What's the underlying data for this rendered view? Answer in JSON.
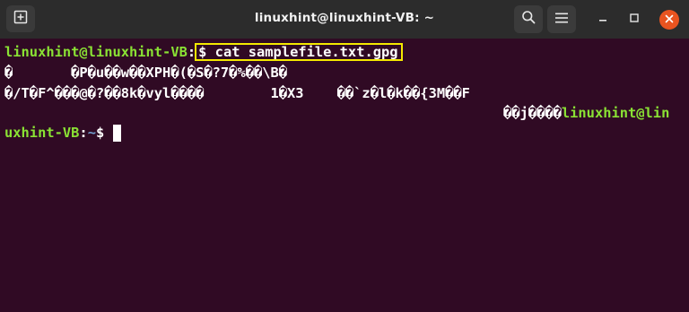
{
  "window": {
    "title": "linuxhint@linuxhint-VB: ~"
  },
  "icons": {
    "new_tab": "new-tab-icon",
    "search": "search-icon",
    "menu": "hamburger-menu-icon",
    "minimize": "minimize-icon",
    "maximize": "maximize-icon",
    "close": "close-icon"
  },
  "colors": {
    "terminal_bg": "#300a24",
    "titlebar_bg": "#2c2c2c",
    "prompt_user": "#8ae234",
    "prompt_path": "#729fcf",
    "highlight_box": "#f4e900",
    "close_button": "#e95420"
  },
  "terminal": {
    "prompt1": {
      "user_host": "linuxhint@linuxhint-VB",
      "colon": ":",
      "command": "$ cat samplefile.txt.gpg"
    },
    "output": {
      "line1": "�       �P�u��w��XPH�(�S�?7�%��\\B�",
      "line2": "�/T�F^���@�?��8k�vyl����        1�X3    ��`z�l�k��{3M��F",
      "line3_garbled": "��j����",
      "line3_user": "linuxhint@lin"
    },
    "prompt2": {
      "user_cont": "uxhint-VB",
      "colon": ":",
      "path": "~",
      "symbol": "$ "
    }
  }
}
